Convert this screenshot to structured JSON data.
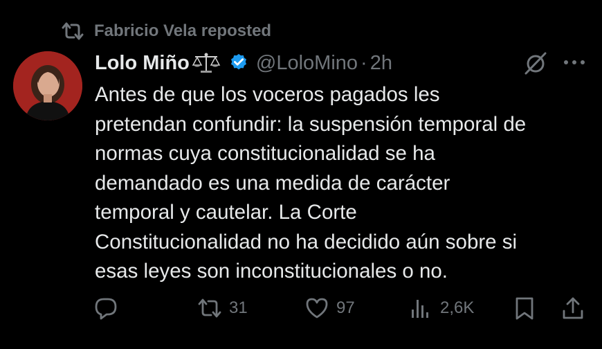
{
  "repost": {
    "text": "Fabricio Vela reposted",
    "icon": "repost-icon"
  },
  "author": {
    "name": "Lolo Miño",
    "name_emoji": "scale-icon",
    "verified": true,
    "handle": "@LoloMino",
    "separator": "·",
    "time": "2h"
  },
  "tweet": {
    "text": "Antes de que los voceros pagados les\npretendan confundir: la suspensión temporal de\nnormas cuya constitucionalidad se ha\ndemandado es una medida de carácter\ntemporal y cautelar. La Corte\nConstitucionalidad no ha decidido aún sobre si\nesas leyes son inconstitucionales o no."
  },
  "actions": {
    "replies": "",
    "reposts": "31",
    "likes": "97",
    "views": "2,6K"
  },
  "colors": {
    "background": "#000000",
    "text": "#e7e9ea",
    "muted": "#71767b",
    "verified": "#1d9bf0"
  }
}
